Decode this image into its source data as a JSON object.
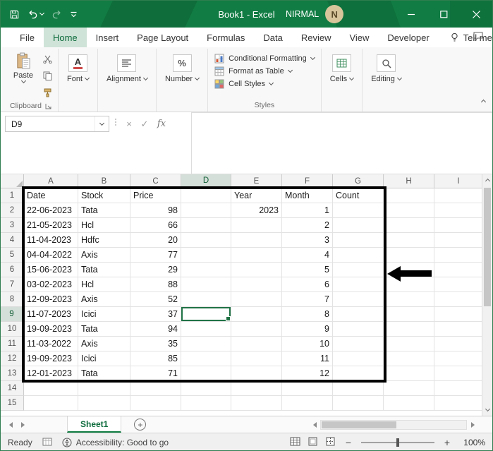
{
  "titlebar": {
    "title": "Book1 - Excel",
    "user": "NIRMAL",
    "avatar_initial": "N"
  },
  "tabs": [
    {
      "label": "File"
    },
    {
      "label": "Home",
      "selected": true
    },
    {
      "label": "Insert"
    },
    {
      "label": "Page Layout"
    },
    {
      "label": "Formulas"
    },
    {
      "label": "Data"
    },
    {
      "label": "Review"
    },
    {
      "label": "View"
    },
    {
      "label": "Developer"
    }
  ],
  "tellme": {
    "label": "Tell me"
  },
  "ribbon": {
    "paste": {
      "label": "Paste"
    },
    "clipboard_group_label": "Clipboard",
    "collapsed_groups": [
      {
        "label": "Font"
      },
      {
        "label": "Alignment"
      },
      {
        "label": "Number"
      }
    ],
    "styles_items": [
      {
        "label": "Conditional Formatting"
      },
      {
        "label": "Format as Table"
      },
      {
        "label": "Cell Styles"
      }
    ],
    "styles_group_label": "Styles",
    "cells_label": "Cells",
    "editing_label": "Editing"
  },
  "formula_bar": {
    "name_box": "D9",
    "cancel": "×",
    "enter": "✓",
    "fx": "fx",
    "value": ""
  },
  "sheet": {
    "col_headers": [
      "A",
      "B",
      "C",
      "D",
      "E",
      "F",
      "G",
      "H",
      "I"
    ],
    "row_count": 15,
    "selected": {
      "col": "D",
      "row": 9
    },
    "rows": [
      [
        "Date",
        "Stock",
        "Price",
        "",
        "Year",
        "Month",
        "Count"
      ],
      [
        "22-06-2023",
        "Tata",
        "98",
        "",
        "2023",
        "1",
        ""
      ],
      [
        "21-05-2023",
        "Hcl",
        "66",
        "",
        "",
        "2",
        ""
      ],
      [
        "11-04-2023",
        "Hdfc",
        "20",
        "",
        "",
        "3",
        ""
      ],
      [
        "04-04-2022",
        "Axis",
        "77",
        "",
        "",
        "4",
        ""
      ],
      [
        "15-06-2023",
        "Tata",
        "29",
        "",
        "",
        "5",
        ""
      ],
      [
        "03-02-2023",
        "Hcl",
        "88",
        "",
        "",
        "6",
        ""
      ],
      [
        "12-09-2023",
        "Axis",
        "52",
        "",
        "",
        "7",
        ""
      ],
      [
        "11-07-2023",
        "Icici",
        "37",
        "",
        "",
        "8",
        ""
      ],
      [
        "19-09-2023",
        "Tata",
        "94",
        "",
        "",
        "9",
        ""
      ],
      [
        "11-03-2022",
        "Axis",
        "35",
        "",
        "",
        "10",
        ""
      ],
      [
        "19-09-2023",
        "Icici",
        "85",
        "",
        "",
        "11",
        ""
      ],
      [
        "12-01-2023",
        "Tata",
        "71",
        "",
        "",
        "12",
        ""
      ]
    ]
  },
  "sheet_tabs": {
    "active": "Sheet1",
    "add": "+"
  },
  "status_bar": {
    "mode": "Ready",
    "accessibility": "Accessibility: Good to go",
    "zoom_out": "−",
    "zoom_in": "+",
    "zoom_level": "100%"
  },
  "colors": {
    "excel_green": "#107c41",
    "selection_green": "#217346",
    "annotation": "#000000"
  }
}
